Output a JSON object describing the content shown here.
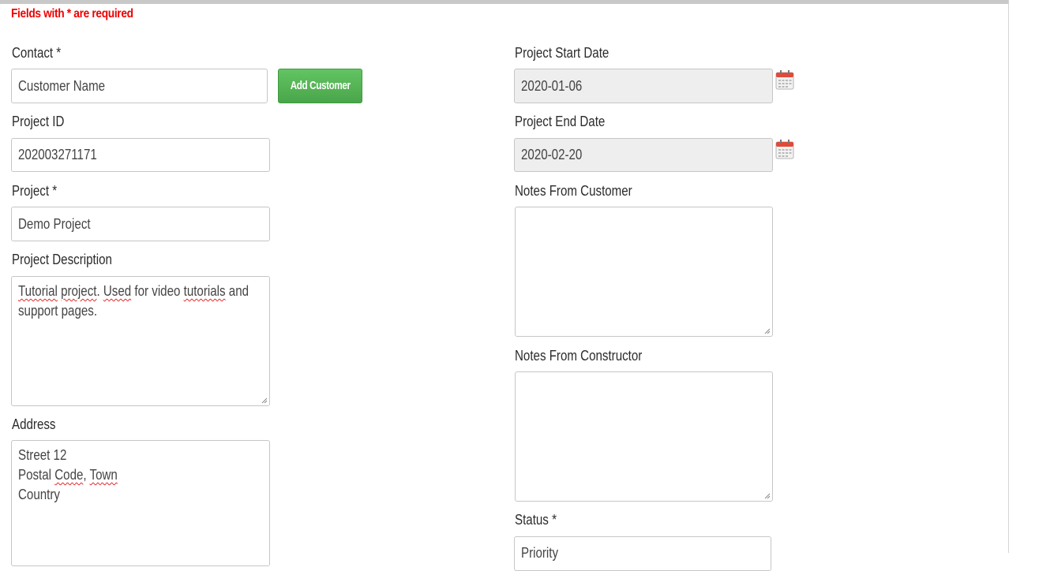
{
  "form": {
    "required_note": "Fields with * are required",
    "left": {
      "contact": {
        "label": "Contact *",
        "value": "Customer Name"
      },
      "add_customer_label": "Add Customer",
      "project_id": {
        "label": "Project ID",
        "value": "202003271171"
      },
      "project": {
        "label": "Project *",
        "value": "Demo Project"
      },
      "project_description": {
        "label": "Project Description",
        "words": [
          "Tutorial",
          "project",
          ".",
          "Used",
          "for video",
          "tutorials",
          "and",
          "support pages."
        ]
      },
      "address": {
        "label": "Address",
        "line1": "Street 12",
        "line2_a": "Postal",
        "line2_b": "Code",
        "line2_c": ",",
        "line2_d": "Town",
        "line3": "Country"
      }
    },
    "right": {
      "start_date": {
        "label": "Project Start Date",
        "value": "2020-01-06",
        "icon": "calendar-icon"
      },
      "end_date": {
        "label": "Project End Date",
        "value": "2020-02-20",
        "icon": "calendar-icon"
      },
      "notes_customer": {
        "label": "Notes From Customer",
        "value": ""
      },
      "notes_constructor": {
        "label": "Notes From Constructor",
        "value": ""
      },
      "status": {
        "label": "Status *",
        "value": "Priority"
      }
    }
  },
  "colors": {
    "required": "#ee0000",
    "button": "#5cb85c",
    "calendar": "#e04a3a"
  }
}
